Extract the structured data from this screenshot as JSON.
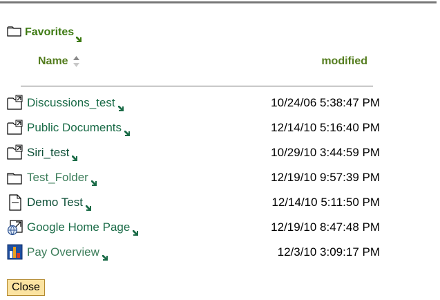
{
  "favorites": {
    "title": "Favorites",
    "folder_icon": "folder-icon",
    "link_icon": "link-arrow-icon"
  },
  "columns": {
    "name": "Name",
    "modified": "modified",
    "sort_icon": "sort-ascending-descending-icon"
  },
  "items": [
    {
      "name": "Discussions_test",
      "modified": "10/24/06 5:38:47 PM",
      "icon": "folder-shortcut-icon"
    },
    {
      "name": "Public Documents",
      "modified": "12/14/10 5:16:40 PM",
      "icon": "folder-shortcut-icon"
    },
    {
      "name": "Siri_test",
      "modified": "10/29/10 3:44:59 PM",
      "icon": "folder-shortcut-icon"
    },
    {
      "name": "Test_Folder",
      "modified": "12/19/10 9:57:39 PM",
      "icon": "folder-icon"
    },
    {
      "name": "Demo Test",
      "modified": "12/14/10 5:11:50 PM",
      "icon": "document-icon"
    },
    {
      "name": "Google Home Page",
      "modified": "12/19/10 8:47:48 PM",
      "icon": "web-link-shortcut-icon"
    },
    {
      "name": "Pay Overview",
      "modified": "12/3/10 3:09:17 PM",
      "icon": "report-chart-icon"
    }
  ],
  "close_button": {
    "label": "Close"
  },
  "colors": {
    "accent_green": "#3d7a12",
    "link_green": "#1a6b47",
    "button_fill": "#fbe3a1"
  }
}
